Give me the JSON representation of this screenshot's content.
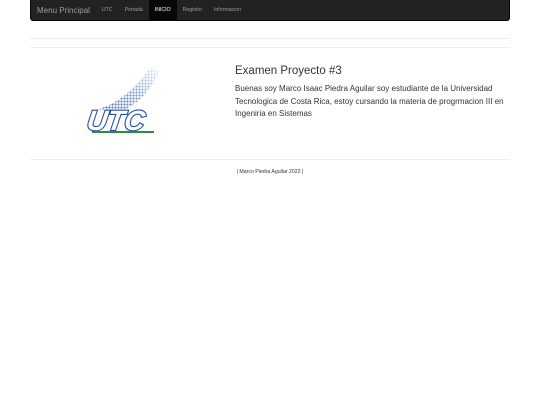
{
  "navbar": {
    "brand": "Menu Principal",
    "items": [
      {
        "label": "UTC",
        "active": false
      },
      {
        "label": "Portada",
        "active": false
      },
      {
        "label": "INICIO",
        "active": true
      },
      {
        "label": "Registro",
        "active": false
      },
      {
        "label": "Informacion",
        "active": false
      }
    ]
  },
  "logo": {
    "text": "UTC"
  },
  "main": {
    "title": "Examen Proyecto #3",
    "description": "Buenas soy Marco Isaac Piedra Aguilar soy estudiante de la Universidad Tecnologica de Costa Rica, estoy cursando la materia de progrmacion III en Ingeniria en Sistemas"
  },
  "footer": {
    "text": "| Marco Piedra Aguilar 2022 |"
  },
  "colors": {
    "navbar_bg": "#222222",
    "logo_blue": "#1f4fa0",
    "logo_green": "#2f8a3a"
  }
}
